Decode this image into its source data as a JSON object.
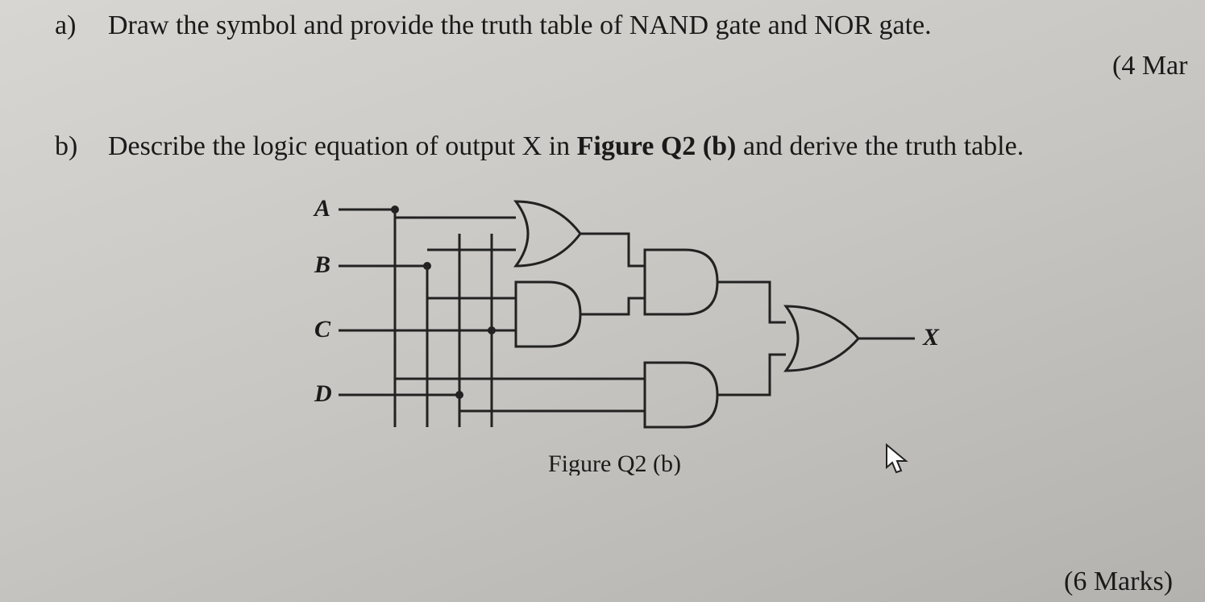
{
  "question": {
    "part_a": {
      "bullet": "a)",
      "text": "Draw the symbol and provide the truth table of NAND gate and NOR gate.",
      "marks": "(4 Mar"
    },
    "part_b": {
      "bullet": "b)",
      "text_prefix": "Describe the logic equation of output X in ",
      "figure_ref": "Figure Q2 (b)",
      "text_suffix": " and derive the truth table.",
      "marks": "(6 Marks)"
    }
  },
  "circuit": {
    "inputs": {
      "A": "A",
      "B": "B",
      "C": "C",
      "D": "D"
    },
    "output": "X",
    "caption": "Figure Q2 (b)",
    "gates": [
      {
        "id": "g1",
        "type": "OR",
        "inputs": [
          "A",
          "B"
        ]
      },
      {
        "id": "g2",
        "type": "AND",
        "inputs": [
          "B",
          "C"
        ]
      },
      {
        "id": "g3",
        "type": "AND",
        "inputs": [
          "g1",
          "g2"
        ]
      },
      {
        "id": "g4",
        "type": "AND",
        "inputs": [
          "A",
          "D"
        ]
      },
      {
        "id": "g5",
        "type": "OR",
        "inputs": [
          "g3",
          "g4"
        ],
        "output": "X"
      }
    ],
    "logic_equation": "X = ((A + B) · (B · C)) + (A · D)"
  }
}
